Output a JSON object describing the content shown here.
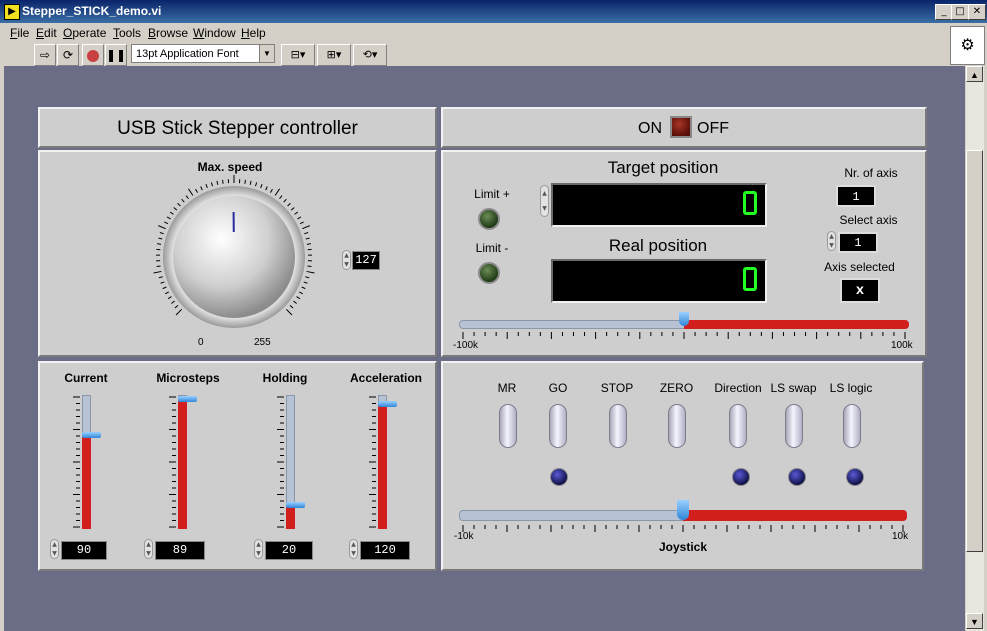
{
  "window": {
    "title": "Stepper_STICK_demo.vi",
    "minimize_glyph": "_",
    "maximize_glyph": "□",
    "close_glyph": "✕"
  },
  "menu": [
    "File",
    "Edit",
    "Operate",
    "Tools",
    "Browse",
    "Window",
    "Help"
  ],
  "toolbar": {
    "font": "13pt Application Font",
    "run_icon": "run-arrow-icon",
    "abort_icon": "stop-icon",
    "pause_icon": "pause-icon"
  },
  "panel": {
    "title": "USB Stick Stepper controller",
    "power": {
      "on_label": "ON",
      "off_label": "OFF",
      "state": "on"
    },
    "max_speed": {
      "label": "Max. speed",
      "min_label": "0",
      "max_label": "255",
      "value": "127",
      "value_num": 127,
      "min": 0,
      "max": 255
    },
    "limits": {
      "plus_label": "Limit  +",
      "minus_label": "Limit  -"
    },
    "target_position": {
      "label": "Target position",
      "value": "0"
    },
    "real_position": {
      "label": "Real position",
      "value": "0"
    },
    "axis": {
      "nr_label": "Nr. of axis",
      "nr_value": "1",
      "select_label": "Select axis",
      "select_value": "1",
      "selected_label": "Axis selected",
      "selected_value": "x"
    },
    "position_slider": {
      "min_label": "-100k",
      "max_label": "100k",
      "fraction": 0.5
    },
    "vsliders": [
      {
        "label": "Current",
        "value": "90",
        "fraction": 0.7
      },
      {
        "label": "Microsteps",
        "value": "89",
        "fraction": 0.97
      },
      {
        "label": "Holding",
        "value": "20",
        "fraction": 0.18
      },
      {
        "label": "Acceleration",
        "value": "120",
        "fraction": 0.93
      }
    ],
    "buttons": [
      "MR",
      "GO",
      "STOP",
      "ZERO",
      "Direction",
      "LS swap",
      "LS logic"
    ],
    "joystick": {
      "label": "Joystick",
      "min_label": "-10k",
      "max_label": "10k",
      "fraction": 0.5
    }
  },
  "colors": {
    "panel_bg": "#6b6d87",
    "frame_bg": "#cecece",
    "slider_red": "#d31e1e",
    "digit_green": "#22ff22",
    "power_led": "#7a1a10"
  }
}
